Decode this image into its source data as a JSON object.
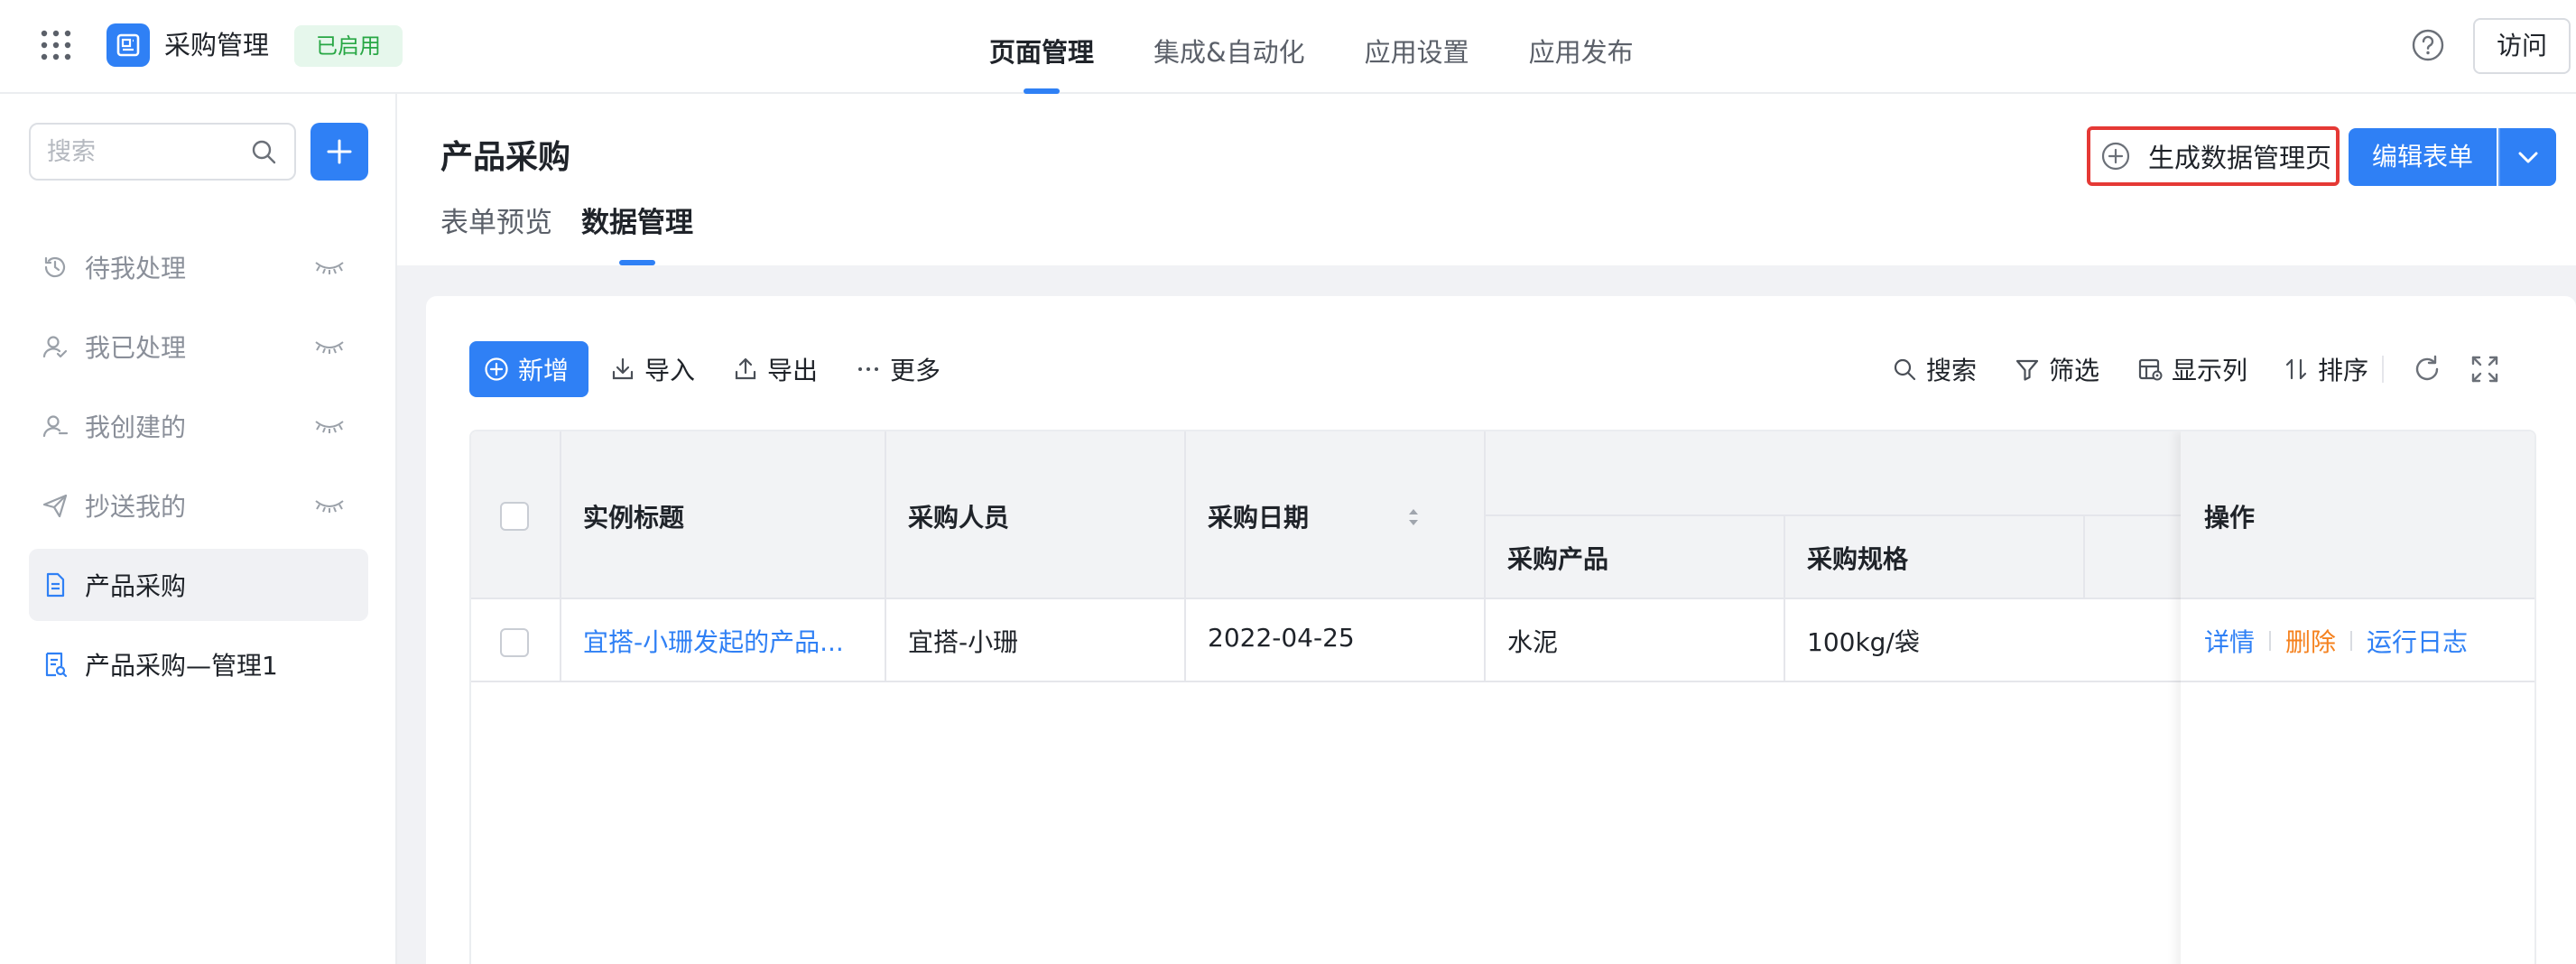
{
  "header": {
    "app_name": "采购管理",
    "status": "已启用",
    "nav": [
      {
        "label": "页面管理",
        "active": true
      },
      {
        "label": "集成&自动化",
        "active": false
      },
      {
        "label": "应用设置",
        "active": false
      },
      {
        "label": "应用发布",
        "active": false
      }
    ],
    "help_icon": "question-circle-icon",
    "visit_label": "访问"
  },
  "sidebar": {
    "search_placeholder": "搜索",
    "items": [
      {
        "label": "待我处理",
        "icon": "clock-icon"
      },
      {
        "label": "我已处理",
        "icon": "user-check-icon"
      },
      {
        "label": "我创建的",
        "icon": "user-add-icon"
      },
      {
        "label": "抄送我的",
        "icon": "paper-plane-icon"
      },
      {
        "label": "产品采购",
        "icon": "form-doc-icon",
        "active": true
      },
      {
        "label": "产品采购—管理1",
        "icon": "report-doc-icon"
      }
    ]
  },
  "main": {
    "title": "产品采购",
    "tabs": [
      {
        "label": "表单预览",
        "active": false
      },
      {
        "label": "数据管理",
        "active": true
      }
    ],
    "generate_label": "生成数据管理页",
    "edit_label": "编辑表单",
    "toolbar": {
      "add": "新增",
      "import": "导入",
      "export": "导出",
      "more": "更多",
      "search": "搜索",
      "filter": "筛选",
      "columns": "显示列",
      "sort": "排序"
    },
    "table": {
      "columns": [
        "实例标题",
        "采购人员",
        "采购日期",
        "采购产品",
        "采购规格",
        "操作"
      ],
      "rows": [
        {
          "title": "宜搭-小珊发起的产品...",
          "buyer": "宜搭-小珊",
          "date": "2022-04-25",
          "product": "水泥",
          "spec": "100kg/袋",
          "actions": [
            "详情",
            "删除",
            "运行日志"
          ]
        }
      ]
    }
  },
  "colors": {
    "accent": "#2f80f5",
    "status_bg": "#e6f7ec",
    "status_text": "#28a745",
    "delete": "#f5821f",
    "highlight_border": "#e53935"
  }
}
